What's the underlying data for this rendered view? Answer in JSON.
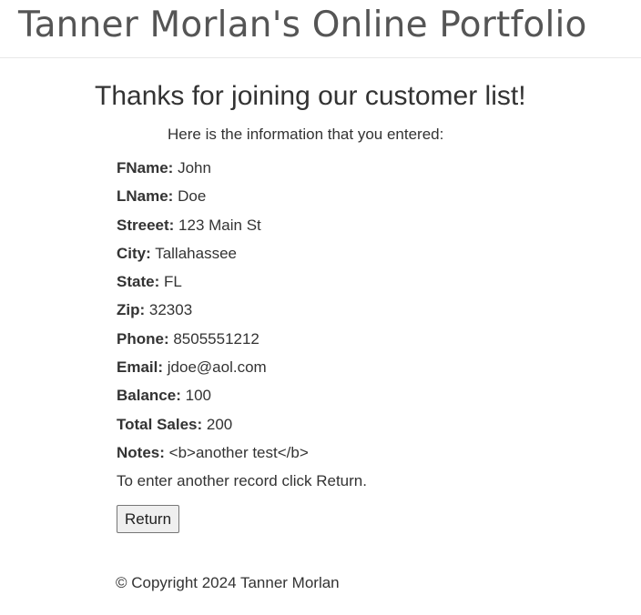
{
  "header": {
    "site_title": "Tanner Morlan's Online Portfolio"
  },
  "main": {
    "heading": "Thanks for joining our customer list!",
    "intro": "Here is the information that you entered:",
    "fields": [
      {
        "label": "FName:",
        "value": "John"
      },
      {
        "label": "LName:",
        "value": "Doe"
      },
      {
        "label": "Streeet:",
        "value": "123 Main St"
      },
      {
        "label": "City:",
        "value": "Tallahassee"
      },
      {
        "label": "State:",
        "value": "FL"
      },
      {
        "label": "Zip:",
        "value": "32303"
      },
      {
        "label": "Phone:",
        "value": "8505551212"
      },
      {
        "label": "Email:",
        "value": "jdoe@aol.com"
      },
      {
        "label": "Balance:",
        "value": "100"
      },
      {
        "label": "Total Sales:",
        "value": "200"
      },
      {
        "label": "Notes:",
        "value": "<b>another test</b>"
      }
    ],
    "return_note": "To enter another record click Return.",
    "return_button_label": "Return"
  },
  "footer": {
    "copyright": "© Copyright 2024 Tanner Morlan"
  }
}
